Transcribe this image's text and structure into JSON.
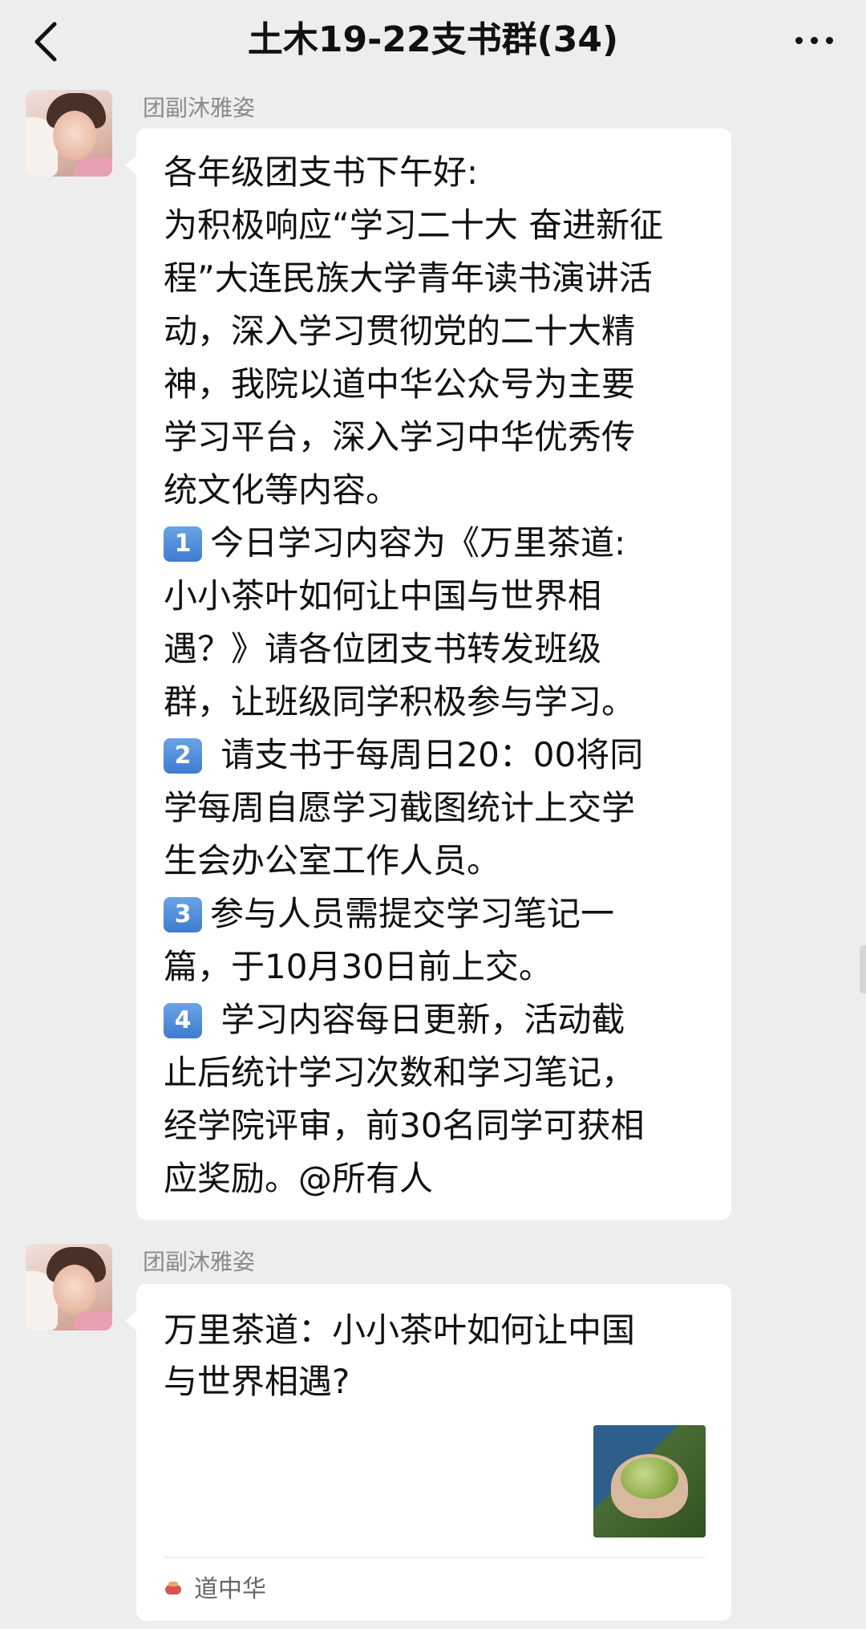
{
  "header": {
    "title": "土木19-22支书群(34)"
  },
  "messages": [
    {
      "sender": "团副沐雅姿",
      "lines": [
        {
          "text": "各年级团支书下午好:"
        },
        {
          "text": "为积极响应“学习二十大 奋进新征"
        },
        {
          "text": "程”大连民族大学青年读书演讲活"
        },
        {
          "text": "动，深入学习贯彻党的二十大精"
        },
        {
          "text": "神，我院以道中华公众号为主要"
        },
        {
          "text": "学习平台，深入学习中华优秀传"
        },
        {
          "text": "统文化等内容。"
        },
        {
          "badge": "1",
          "text": "今日学习内容为《万里茶道:"
        },
        {
          "text": "小小茶叶如何让中国与世界相"
        },
        {
          "text": "遇？》请各位团支书转发班级"
        },
        {
          "text": "群，让班级同学积极参与学习。"
        },
        {
          "badge": "2",
          "text": " 请支书于每周日20：00将同"
        },
        {
          "text": "学每周自愿学习截图统计上交学"
        },
        {
          "text": "生会办公室工作人员。"
        },
        {
          "badge": "3",
          "text": "参与人员需提交学习笔记一"
        },
        {
          "text": "篇，于10月30日前上交。"
        },
        {
          "badge": "4",
          "text": " 学习内容每日更新，活动截"
        },
        {
          "text": "止后统计学习次数和学习笔记，"
        },
        {
          "text": "经学院评审，前30名同学可获相"
        },
        {
          "text": "应奖励。@所有人"
        }
      ]
    },
    {
      "sender": "团副沐雅姿",
      "card": {
        "title_lines": [
          "万里茶道：小小茶叶如何让中国",
          "与世界相遇?"
        ],
        "source": "道中华"
      }
    }
  ]
}
